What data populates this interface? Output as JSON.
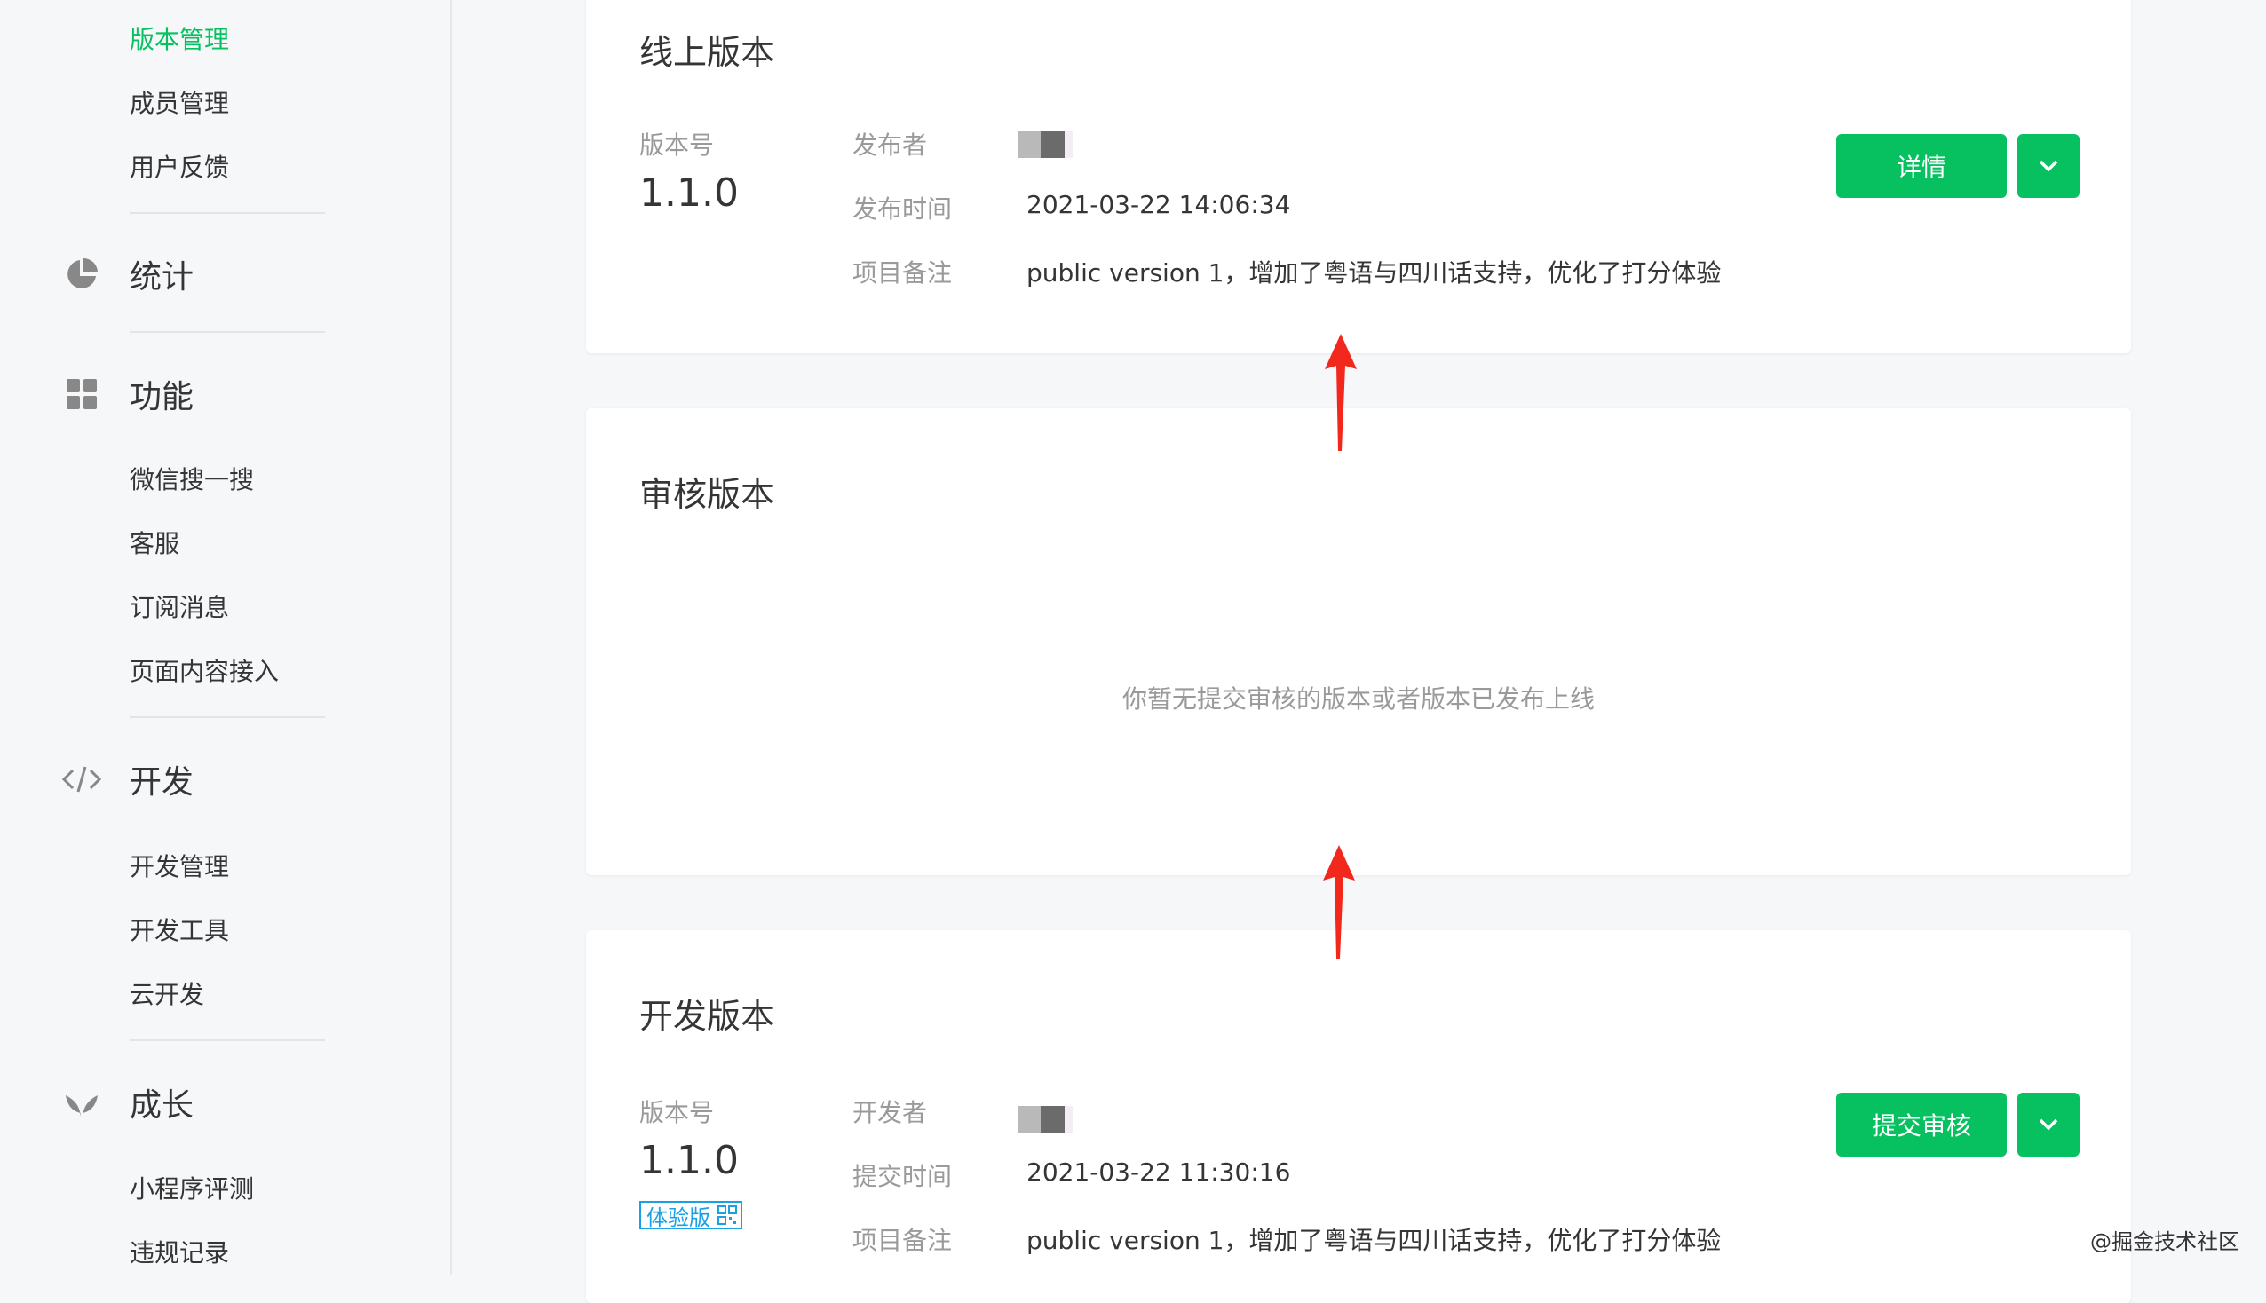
{
  "sidebar": {
    "top_items": [
      "版本管理",
      "成员管理",
      "用户反馈"
    ],
    "groups": {
      "stats": {
        "label": "统计",
        "icon": "pie-chart-icon"
      },
      "features": {
        "label": "功能",
        "icon": "grid-icon",
        "items": [
          "微信搜一搜",
          "客服",
          "订阅消息",
          "页面内容接入"
        ]
      },
      "dev": {
        "label": "开发",
        "icon": "code-icon",
        "items": [
          "开发管理",
          "开发工具",
          "云开发"
        ]
      },
      "growth": {
        "label": "成长",
        "icon": "sprout-icon",
        "items": [
          "小程序评测",
          "违规记录"
        ]
      }
    }
  },
  "online": {
    "title": "线上版本",
    "version_label": "版本号",
    "version": "1.1.0",
    "publisher_label": "发布者",
    "time_label": "发布时间",
    "time": "2021-03-22 14:06:34",
    "note_label": "项目备注",
    "note": "public version 1，增加了粤语与四川话支持，优化了打分体验",
    "detail_button": "详情"
  },
  "review": {
    "title": "审核版本",
    "empty": "你暂无提交审核的版本或者版本已发布上线"
  },
  "dev_version": {
    "title": "开发版本",
    "version_label": "版本号",
    "version": "1.1.0",
    "tag": "体验版",
    "developer_label": "开发者",
    "time_label": "提交时间",
    "time": "2021-03-22 11:30:16",
    "note_label": "项目备注",
    "note": "public version 1，增加了粤语与四川话支持，优化了打分体验",
    "submit_button": "提交审核"
  },
  "colors": {
    "accent": "#07c160",
    "tag": "#1aa1e5",
    "arrow": "#f2281d"
  },
  "watermark": "@掘金技术社区"
}
